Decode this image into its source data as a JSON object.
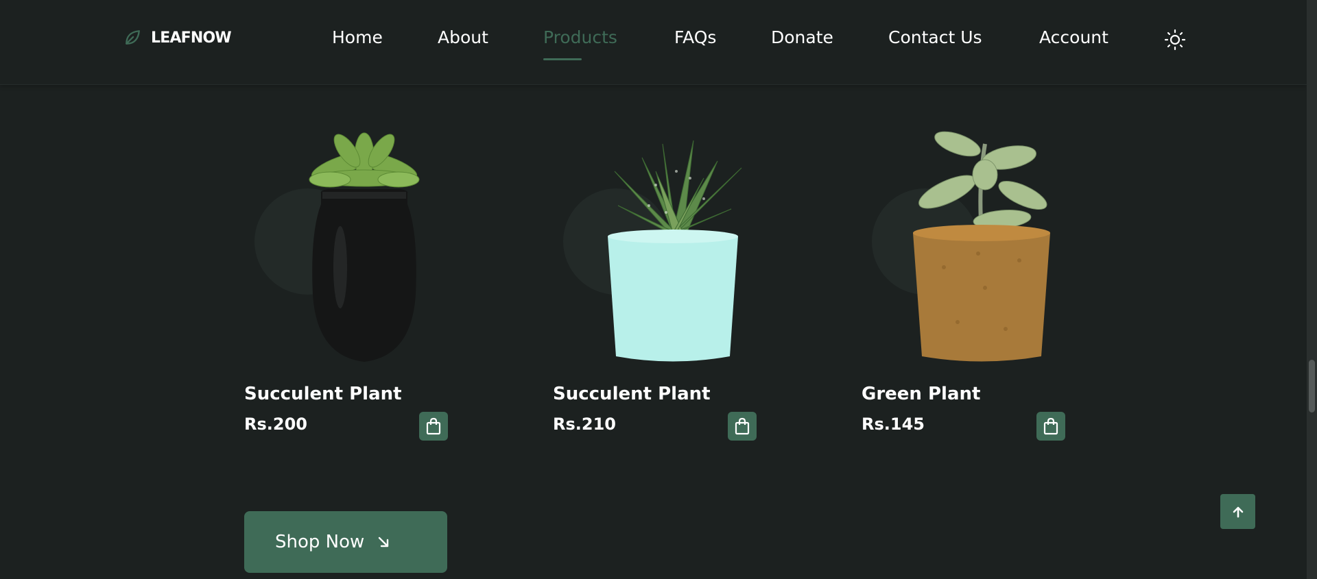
{
  "brand": {
    "name": "LEAFNOW",
    "icon": "leaf-icon"
  },
  "nav": {
    "items": [
      {
        "label": "Home"
      },
      {
        "label": "About"
      },
      {
        "label": "Products",
        "active": true
      },
      {
        "label": "FAQs"
      },
      {
        "label": "Donate"
      },
      {
        "label": "Contact Us"
      },
      {
        "label": "Account"
      }
    ],
    "theme_icon": "sun-icon"
  },
  "products": [
    {
      "name": "Succulent Plant",
      "price": "Rs.200",
      "pot": "black ceramic pot"
    },
    {
      "name": "Succulent Plant",
      "price": "Rs.210",
      "pot": "mint ceramic pot"
    },
    {
      "name": "Green Plant",
      "price": "Rs.145",
      "pot": "coir pot"
    }
  ],
  "cta": {
    "shop_now": "Shop Now",
    "icon": "arrow-down-right-icon"
  },
  "back_to_top_icon": "arrow-up-icon",
  "colors": {
    "background": "#1c2120",
    "accent": "#3f6b57",
    "text": "#ffffff"
  }
}
